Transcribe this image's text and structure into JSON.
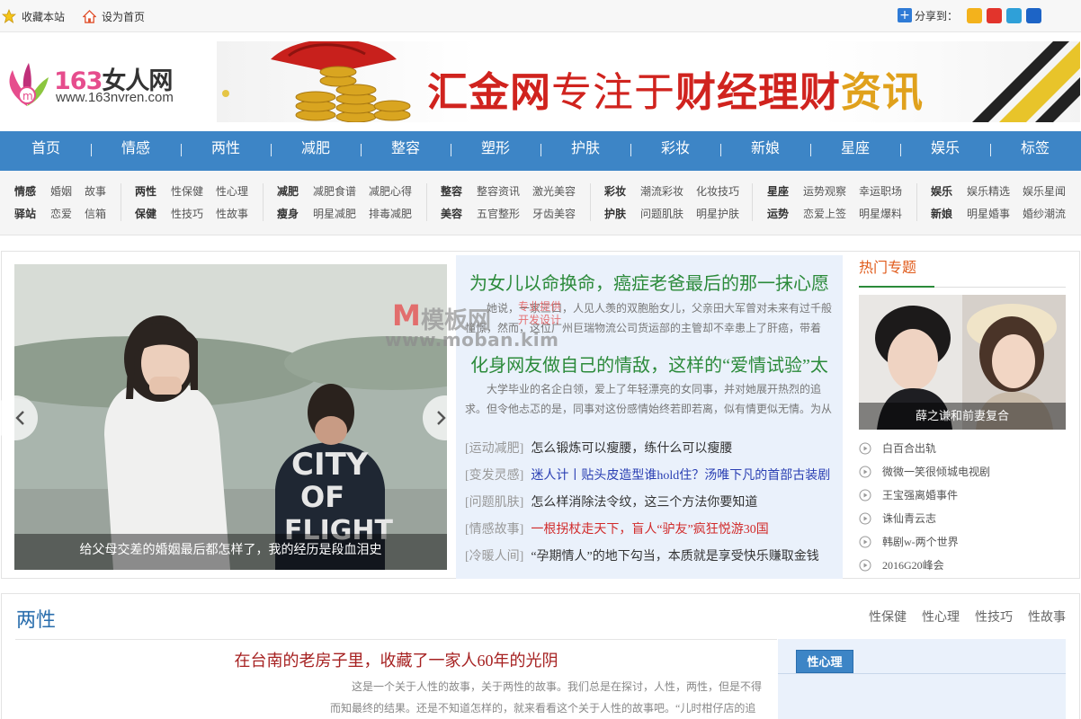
{
  "topbar": {
    "favorite": "收藏本站",
    "homepage": "设为首页",
    "share_label": "分享到："
  },
  "logo": {
    "brand_num": "163",
    "brand_word": "女人网",
    "url": "www.163nvren.com"
  },
  "banner": {
    "part1": "汇金网",
    "part2": "专注于",
    "part3": "财经理财",
    "part4": "资讯"
  },
  "nav": [
    "首页",
    "情感",
    "两性",
    "减肥",
    "整容",
    "塑形",
    "护肤",
    "彩妆",
    "新娘",
    "星座",
    "娱乐",
    "标签"
  ],
  "subnav": [
    [
      [
        "情感",
        "婚姻",
        "故事"
      ],
      [
        "驿站",
        "恋爱",
        "信箱"
      ]
    ],
    [
      [
        "两性",
        "性保健",
        "性心理"
      ],
      [
        "保健",
        "性技巧",
        "性故事"
      ]
    ],
    [
      [
        "减肥",
        "减肥食谱",
        "减肥心得"
      ],
      [
        "瘦身",
        "明星减肥",
        "排毒减肥"
      ]
    ],
    [
      [
        "整容",
        "整容资讯",
        "激光美容"
      ],
      [
        "美容",
        "五官整形",
        "牙齿美容"
      ]
    ],
    [
      [
        "彩妆",
        "潮流彩妆",
        "化妆技巧"
      ],
      [
        "护肤",
        "问题肌肤",
        "明星护肤"
      ]
    ],
    [
      [
        "星座",
        "运势观察",
        "幸运职场"
      ],
      [
        "运势",
        "恋爱上签",
        "明星爆料"
      ]
    ],
    [
      [
        "娱乐",
        "娱乐精选",
        "娱乐星闻"
      ],
      [
        "新娘",
        "明星婚事",
        "婚纱潮流"
      ]
    ]
  ],
  "slider": {
    "caption": "给父母交差的婚姻最后都怎样了，我的经历是段血泪史"
  },
  "watermark": {
    "m": "M",
    "cn": "模板网",
    "small1": "专业提供",
    "small2": "开发设计",
    "url": "www.moban.kim"
  },
  "headlines": {
    "h1": "为女儿以命换命，癌症老爸最后的那一抹心愿",
    "d1": "她说，一家三口，人见人羡的双胞胎女儿，父亲田大军曾对未来有过千般憧憬，然而，这位广州巨瑞物流公司货运部的主管却不幸患上了肝癌，带着",
    "h2": "化身网友做自己的情敌，这样的“爱情试验”太",
    "d2": "大学毕业的名企白领，爱上了年轻漂亮的女同事，并对她展开热烈的追求。但令他忐忑的是，同事对这份感情始终若即若离，似有情更似无情。为从"
  },
  "news": [
    {
      "tag": "[运动减肥]",
      "title": "怎么锻炼可以瘦腰，练什么可以瘦腰",
      "color": "#333333"
    },
    {
      "tag": "[变发灵感]",
      "title": "迷人计丨贴头皮造型谁hold住？汤唯下凡的首部古装剧",
      "color": "#2a3fb3"
    },
    {
      "tag": "[问题肌肤]",
      "title": "怎么样消除法令纹，这三个方法你要知道",
      "color": "#333333"
    },
    {
      "tag": "[情感故事]",
      "title": "一根拐杖走天下，盲人“驴友”疯狂悦游30国",
      "color": "#d12a2a"
    },
    {
      "tag": "[冷暖人间]",
      "title": "“孕期情人”的地下勾当，本质就是享受快乐赚取金钱",
      "color": "#333333"
    }
  ],
  "hot": {
    "title": "热门专题",
    "caption": "薛之谦和前妻复合",
    "items": [
      "白百合出轨",
      "微微一笑很倾城电视剧",
      "王宝强离婚事件",
      "诛仙青云志",
      "韩剧w-两个世界",
      "2016G20峰会"
    ]
  },
  "section2": {
    "title": "两性",
    "links": [
      "性保健",
      "性心理",
      "性技巧",
      "性故事"
    ],
    "headline": "在台南的老房子里，收藏了一家人60年的光阴",
    "desc": "这是一个关于人性的故事，关于两性的故事。我们总是在探讨，人性，两性，但是不得而知最终的结果。还是不知道怎样的，就来看看这个关于人性的故事吧。“儿时柑仔店的追",
    "side_tab": "性心理"
  }
}
